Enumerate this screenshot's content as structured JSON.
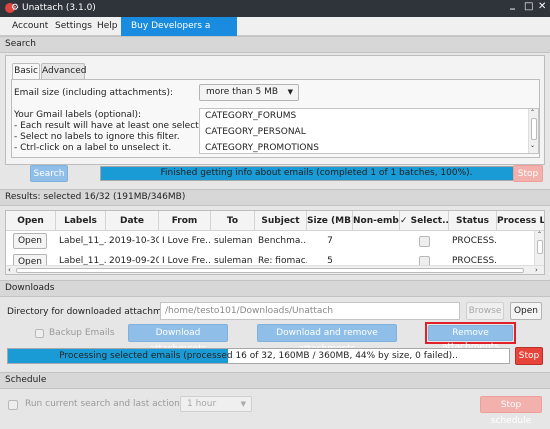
{
  "window": {
    "title": "Unattach (3.1.0)",
    "controls": [
      "_",
      "□",
      "✕"
    ]
  },
  "menu": {
    "items": [
      "Account",
      "Settings",
      "Help"
    ],
    "highlight": "Buy Developers a Coffee"
  },
  "search": {
    "section_title": "Search",
    "tabs": [
      "Basic",
      "Advanced"
    ],
    "email_size_label": "Email size (including attachments):",
    "email_size_value": "more than 5 MB",
    "labels_help": [
      "Your Gmail labels (optional):",
      "- Each result will have at least one selected label.",
      "- Select no labels to ignore this filter.",
      "- Ctrl-click on a label to unselect it."
    ],
    "label_options": [
      "CATEGORY_FORUMS",
      "CATEGORY_PERSONAL",
      "CATEGORY_PROMOTIONS"
    ],
    "search_button": "Search",
    "progress_text": "Finished getting info about emails (completed 1 of 1 batches, 100%).",
    "progress_fraction": 1.0,
    "stop_button": "Stop"
  },
  "results": {
    "section_title": "Results: selected 16/32 (191MB/346MB)",
    "columns": [
      "Open",
      "Labels",
      "Date",
      "From",
      "To",
      "Subject",
      "Size (MB)",
      "Non-emb...",
      "✓  Select...",
      "Status",
      "Process L..."
    ],
    "rows": [
      {
        "open": "Open",
        "labels": "Label_11_...",
        "date": "2019-10-30",
        "from": "I Love Fre...",
        "to": "suleman ...",
        "subject": "Benchma...",
        "size": "7",
        "status": "PROCESS..."
      },
      {
        "open": "Open",
        "labels": "Label_11_...",
        "date": "2019-09-20",
        "from": "I Love Fre...",
        "to": "suleman ...",
        "subject": "Re: fiomac...",
        "size": "5",
        "status": "PROCESS..."
      }
    ]
  },
  "downloads": {
    "section_title": "Downloads",
    "dir_label": "Directory for downloaded attachments:",
    "dir_value": "/home/testo101/Downloads/Unattach",
    "browse_button": "Browse",
    "open_button": "Open",
    "backup_label": "Backup Emails",
    "download_button": "Download attachments",
    "download_remove_button": "Download and remove attachments",
    "remove_button": "Remove attachments",
    "progress_text": "Processing selected emails (processed 16 of 32, 160MB / 360MB, 44% by size, 0 failed)..",
    "progress_fraction": 0.44,
    "stop_button": "Stop"
  },
  "schedule": {
    "section_title": "Schedule",
    "run_label": "Run current search and last action every",
    "interval_value": "1 hour",
    "stop_schedule_button": "Stop schedule"
  }
}
